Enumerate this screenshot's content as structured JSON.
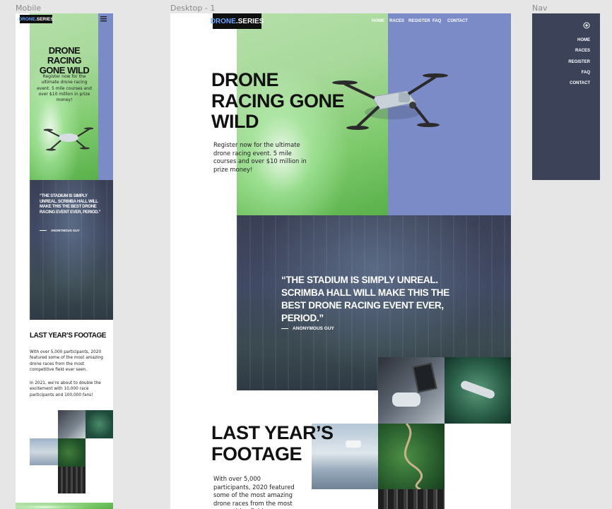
{
  "frames": {
    "mobile_label": "Mobile",
    "desktop_label": "Desktop - 1",
    "nav_label": "Nav"
  },
  "brand": {
    "logo_main": "DRONE",
    "logo_dot": ".SERIES",
    "accent_color": "#6aa4ff",
    "green_color": "#a8d99b",
    "blue_color": "#7b8bc8",
    "dark_color": "#3c4258"
  },
  "nav": {
    "items": [
      "HOME",
      "RACES",
      "REGISTER",
      "FAQ",
      "CONTACT"
    ],
    "menu_icon": "hamburger-icon",
    "close_icon": "close-circle-icon"
  },
  "hero": {
    "title_line1": "DRONE",
    "title_line2": "RACING GONE",
    "title_line3": "WILD",
    "mobile_title_line1": "DRONE RACING",
    "mobile_title_line2": "GONE WILD",
    "text": "Register now for the ultimate drone racing event. 5 mile courses and over $10 million in prize money!"
  },
  "quote": {
    "text": "“The stadium is simply unreal. Scrimba Hall will make this the best drone racing event ever, period.”",
    "author": "Anonymous Guy"
  },
  "footage": {
    "title_line1": "LAST YEAR’S",
    "title_line2": "FOOTAGE",
    "mobile_title": "LAST YEAR’S FOOTAGE",
    "para1": "With over 5,000 participants, 2020 featured some of the most amazing drone races from the most competitive field ever seen.",
    "para2": "In 2021, we’re about to double the excitement with 10,000 race participants and 100,000 fans!"
  }
}
